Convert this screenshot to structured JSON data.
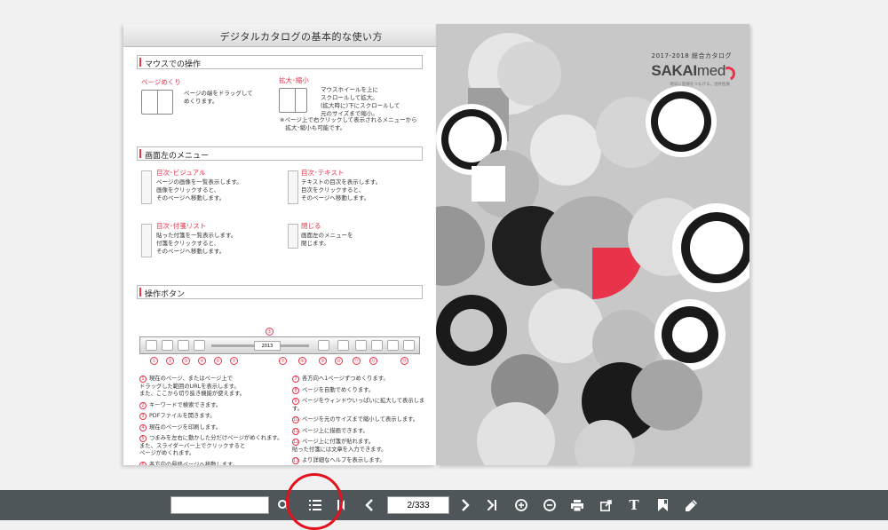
{
  "left_page": {
    "title": "デジタルカタログの基本的な使い方",
    "mouse_section": {
      "heading": "マウスでの操作",
      "page_turn_title": "ページめくり",
      "page_turn_text": "ページの端をドラッグして\nめくります。",
      "zoom_title": "拡大･縮小",
      "zoom_text": "マウスホイールを上に\nスクロールして拡大。\n(拡大時に)下にスクロールして\n元のサイズまで縮小。",
      "zoom_note": "※ページ上で右クリックして表示されるメニューから\n　拡大･縮小も可能です。"
    },
    "menu_section": {
      "heading": "画面左のメニュー",
      "items": [
        {
          "title": "目次･ビジュアル",
          "text": "ページの画像を一覧表示します。\n画像をクリックすると、\nそのページへ移動します。"
        },
        {
          "title": "目次･テキスト",
          "text": "テキストの目次を表示します。\n目次をクリックすると、\nそのページへ移動します。"
        },
        {
          "title": "目次･付箋リスト",
          "text": "貼った付箋を一覧表示します。\n付箋をクリックすると、\nそのページへ移動します。"
        },
        {
          "title": "閉じる",
          "text": "画面左のメニューを\n閉じます。"
        }
      ]
    },
    "buttons_section": {
      "heading": "操作ボタン",
      "bar_page_value": "2013",
      "bar_numbers": [
        "①",
        "②",
        "③",
        "④",
        "⑤",
        "⑥",
        "⑦",
        "⑧",
        "⑨",
        "⑩",
        "⑪",
        "⑫",
        "⑬"
      ],
      "items_left": [
        {
          "n": "1",
          "text": "現在のページ、またはページ上で\nドラッグした範囲のURLを表示します。\nまた、ここから切り抜き機能が使えます。"
        },
        {
          "n": "2",
          "text": "キーワードで検索できます。"
        },
        {
          "n": "3",
          "text": "PDFファイルを開きます。"
        },
        {
          "n": "4",
          "text": "現在のページを印刷します。"
        },
        {
          "n": "5",
          "text": "つまみを左右に動かした分だけページがめくれます。\nまた、スライダーバー上でクリックすると\nページがめくれます。"
        },
        {
          "n": "6",
          "text": "各方向の最終ページへ移動します。"
        }
      ],
      "items_right": [
        {
          "n": "7",
          "text": "各方向へ1ページずつめくります。"
        },
        {
          "n": "8",
          "text": "ページを自動でめくります。"
        },
        {
          "n": "9",
          "text": "ページをウィンドウいっぱいに拡大して表示します。"
        },
        {
          "n": "10",
          "text": "ページを元のサイズまで縮小して表示します。"
        },
        {
          "n": "11",
          "text": "ページ上に描画できます。"
        },
        {
          "n": "12",
          "text": "ページ上に付箋が貼れます。\n貼った付箋には文章を入力できます。"
        },
        {
          "n": "13",
          "text": "より詳細なヘルプを表示します。"
        }
      ]
    }
  },
  "right_page": {
    "year_label": "2017-2018  総合カタログ",
    "brand_bold": "SAKAI",
    "brand_light": "med",
    "tagline": "明日に医療をつなげる。酒井医療"
  },
  "toolbar": {
    "search_value": "",
    "page_value": "2/333",
    "icons": [
      "search-icon",
      "toc-list-icon",
      "first-page-icon",
      "prev-page-icon",
      "next-page-icon",
      "last-page-icon",
      "zoom-in-icon",
      "zoom-out-icon",
      "print-icon",
      "share-icon",
      "text-icon",
      "bookmark-icon",
      "pen-icon"
    ]
  },
  "colors": {
    "accent": "#e8334a",
    "toolbar_bg": "#4f5659",
    "highlight": "#e4111e"
  }
}
